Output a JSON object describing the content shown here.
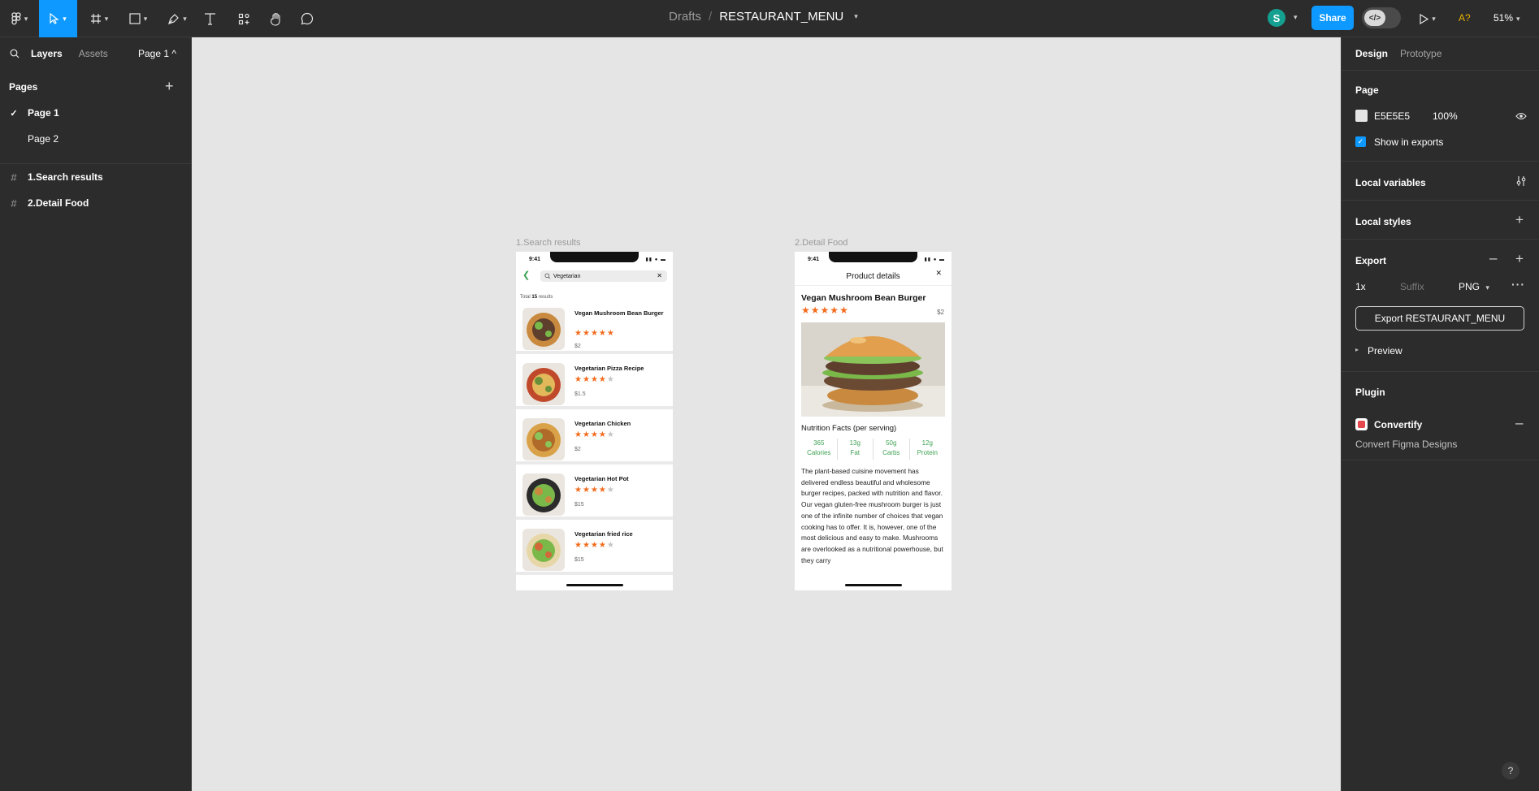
{
  "toolbar": {
    "breadcrumb": "Drafts",
    "separator": "/",
    "file_name": "RESTAURANT_MENU",
    "avatar_initial": "S",
    "share_label": "Share",
    "dev_mode_label": "</>",
    "a_q_label": "A?",
    "zoom": "51%"
  },
  "left": {
    "tabs": [
      "Layers",
      "Assets"
    ],
    "page_select": "Page 1 ^",
    "pages_heading": "Pages",
    "pages": [
      {
        "label": "Page 1",
        "selected": true
      },
      {
        "label": "Page 2",
        "selected": false
      }
    ],
    "layers": [
      "1.Search results",
      "2.Detail Food"
    ]
  },
  "canvas": {
    "background": "#E5E5E5",
    "frame1_label": "1.Search results",
    "frame2_label": "2.Detail Food",
    "status_time": "9:41",
    "search": {
      "query": "Vegetarian",
      "total_prefix": "Total",
      "total_count": "15",
      "total_suffix": "results"
    },
    "items": [
      {
        "name": "Vegan Mushroom Bean Burger",
        "rating": 5,
        "price": "$2",
        "thumb": "burger"
      },
      {
        "name": "Vegetarian Pizza Recipe",
        "rating": 4,
        "price": "$1.5",
        "thumb": "pizza"
      },
      {
        "name": "Vegetarian Chicken",
        "rating": 4,
        "price": "$2",
        "thumb": "chicken"
      },
      {
        "name": "Vegetarian Hot Pot",
        "rating": 4,
        "price": "$15",
        "thumb": "hotpot"
      },
      {
        "name": "Vegetarian fried rice",
        "rating": 4,
        "price": "$15",
        "thumb": "rice"
      }
    ],
    "detail": {
      "header": "Product details",
      "title": "Vegan Mushroom Bean Burger",
      "rating": 5,
      "price": "$2",
      "nutrition_title": "Nutrition Facts (per serving)",
      "nutrition": [
        {
          "value": "365",
          "label": "Calories"
        },
        {
          "value": "13g",
          "label": "Fat"
        },
        {
          "value": "50g",
          "label": "Carbs"
        },
        {
          "value": "12g",
          "label": "Protein"
        }
      ],
      "description": "The plant-based cuisine movement has delivered endless beautiful and wholesome burger recipes, packed with nutrition and flavor. Our vegan gluten-free mushroom burger is just one of the infinite number of choices that vegan cooking has to offer. It is, however, one of the most delicious and easy to make. Mushrooms are overlooked as a nutritional powerhouse, but they carry"
    },
    "accent_color": "#3EA354",
    "star_color": "#F26B1D"
  },
  "right": {
    "tabs": [
      "Design",
      "Prototype"
    ],
    "page_heading": "Page",
    "page_color": "E5E5E5",
    "page_opacity": "100%",
    "show_in_exports": "Show in exports",
    "local_variables": "Local variables",
    "local_styles": "Local styles",
    "export_heading": "Export",
    "export_scale": "1x",
    "export_suffix_placeholder": "Suffix",
    "export_format": "PNG",
    "export_button": "Export RESTAURANT_MENU",
    "preview": "Preview",
    "plugin_heading": "Plugin",
    "plugin_name": "Convertify",
    "plugin_desc": "Convert Figma Designs"
  },
  "help": "?"
}
